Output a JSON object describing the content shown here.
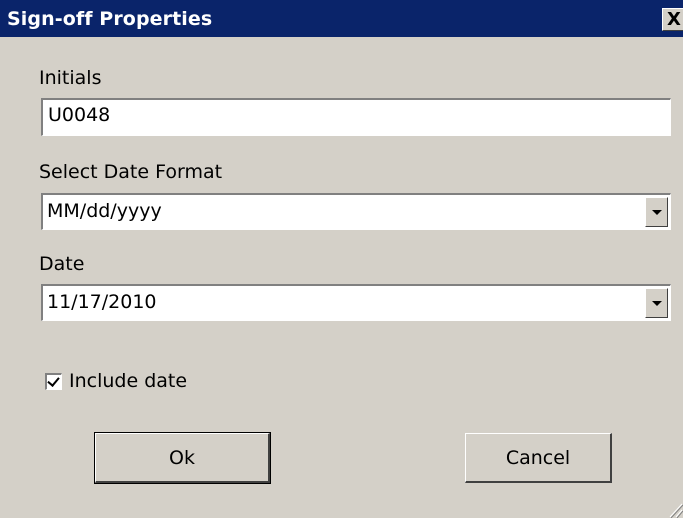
{
  "window": {
    "title": "Sign-off Properties",
    "close_label": "X"
  },
  "initials": {
    "label": "Initials",
    "value": "U0048"
  },
  "date_format": {
    "label": "Select Date Format",
    "value": "MM/dd/yyyy"
  },
  "date": {
    "label": "Date",
    "value": "11/17/2010"
  },
  "include_date": {
    "label": "Include date",
    "checked": true
  },
  "buttons": {
    "ok": "Ok",
    "cancel": "Cancel"
  },
  "colors": {
    "titlebar": "#0a246a",
    "face": "#d4d0c8"
  }
}
